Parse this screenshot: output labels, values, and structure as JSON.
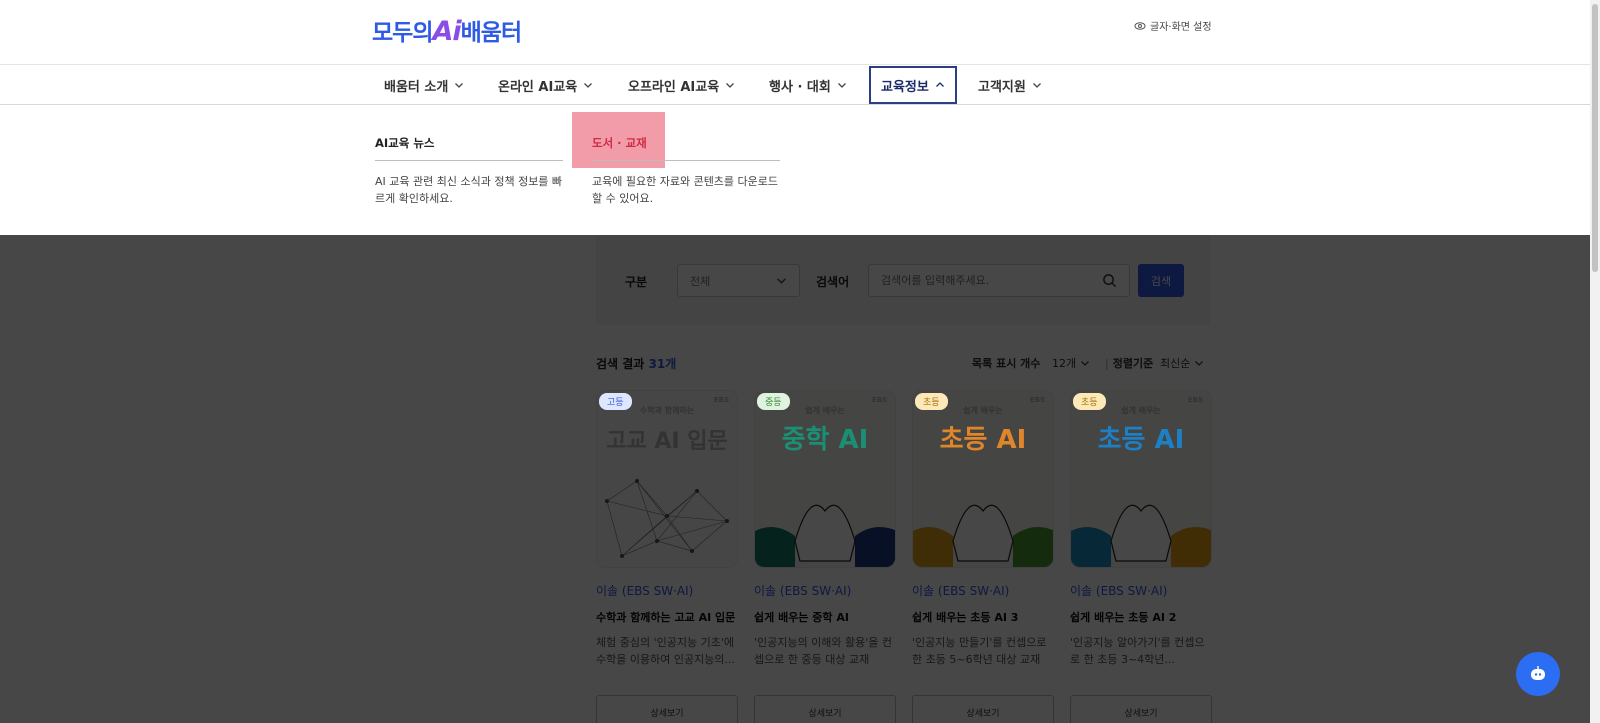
{
  "header": {
    "logo_text_1": "모두의",
    "logo_text_ai": "Ai",
    "logo_text_2": "배움터",
    "font_setting": "글자·화면 설정"
  },
  "gnb": {
    "items": [
      {
        "label": "배움터 소개"
      },
      {
        "label": "온라인 AI교육"
      },
      {
        "label": "오프라인 AI교육"
      },
      {
        "label": "행사 · 대회"
      },
      {
        "label": "교육정보"
      },
      {
        "label": "고객지원"
      }
    ]
  },
  "mega_menu": {
    "col1": {
      "title": "AI교육 뉴스",
      "desc": "AI 교육 관련 최신 소식과 정책 정보를 빠르게 확인하세요."
    },
    "col2": {
      "title": "도서 · 교재",
      "desc": "교육에 필요한 자료와 콘텐츠를 다운로드할 수 있어요."
    }
  },
  "search": {
    "category_label": "구분",
    "category_value": "전체",
    "keyword_label": "검색어",
    "keyword_placeholder": "검색어를 입력해주세요.",
    "button": "검색"
  },
  "results": {
    "title_prefix": "검색 결과",
    "count": "31개",
    "per_page_label": "목록 표시 개수",
    "per_page_value": "12개",
    "sort_label": "정렬기준",
    "sort_value": "최신순"
  },
  "books": [
    {
      "tag": "고등",
      "publisher": "EBS",
      "cover_title": "고교 AI 입문",
      "cover_top": "수학과 함께하는",
      "author": "이솔 (EBS SW·AI)",
      "name": "수학과 함께하는 고교 AI 입문",
      "desc": "체험 중심의 '인공지능 기초'에 수학을 이용하여 인공지능의...",
      "button": "상세보기"
    },
    {
      "tag": "중등",
      "publisher": "EBS",
      "cover_title": "중학 AI",
      "cover_top": "쉽게 배우는",
      "author": "이솔 (EBS SW·AI)",
      "name": "쉽게 배우는 중학 AI",
      "desc": "'인공지능의 이해와 활용'을 컨셉으로 한 중등 대상 교재",
      "button": "상세보기"
    },
    {
      "tag": "초등",
      "publisher": "EBS",
      "cover_title": "초등 AI",
      "cover_top": "쉽게 배우는",
      "author": "이솔 (EBS SW·AI)",
      "name": "쉽게 배우는 초등 AI 3",
      "desc": "'인공지능 만들기'를 컨셉으로 한 초등 5~6학년 대상 교재",
      "button": "상세보기"
    },
    {
      "tag": "초등",
      "publisher": "EBS",
      "cover_title": "초등 AI",
      "cover_top": "쉽게 배우는",
      "author": "이솔 (EBS SW·AI)",
      "name": "쉽게 배우는 초등 AI 2",
      "desc": "'인공지능 알아가기'를 컨셉으로 한 초등 3~4학년...",
      "button": "상세보기"
    }
  ],
  "colors": {
    "brand": "#2e5be6",
    "accent_ai": "#8b4de8",
    "highlight": "#f08b9a",
    "active_nav": "#2a3f86"
  },
  "icons": {
    "font_setting": "eye-icon",
    "chevron": "chevron-down-icon",
    "search": "search-icon",
    "chatbot": "chatbot-icon"
  }
}
